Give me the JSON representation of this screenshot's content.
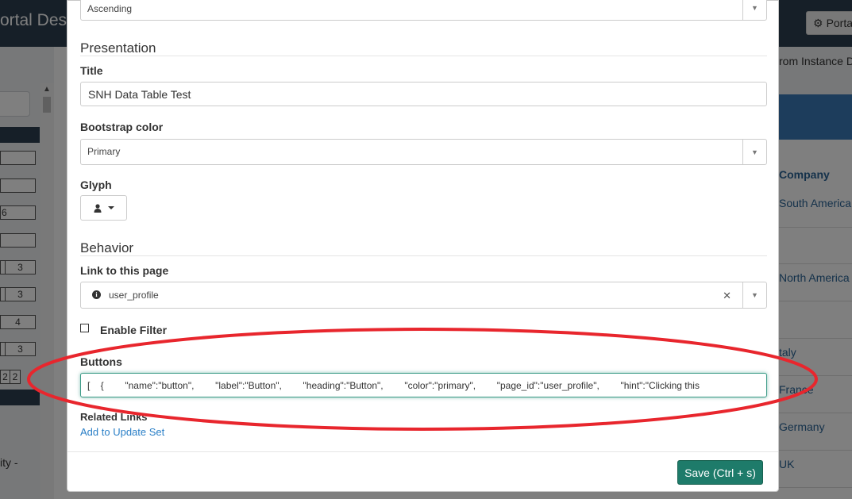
{
  "background": {
    "brand_title": "ortal Des",
    "portal_button_label": "Porta",
    "subheader_text": "rom Instance D",
    "left_numbers": [
      "6",
      "3",
      "3",
      "4",
      "3",
      "2",
      "2"
    ],
    "left_bottom_text": "ity -",
    "right_column_header": "Company",
    "right_rows": [
      "South America",
      "North America",
      "taly",
      "France",
      "Germany",
      "UK"
    ]
  },
  "modal": {
    "sort_order_select": "Ascending",
    "presentation_heading": "Presentation",
    "title_label": "Title",
    "title_value": "SNH Data Table Test",
    "bootstrap_color_label": "Bootstrap color",
    "bootstrap_color_value": "Primary",
    "glyph_label": "Glyph",
    "glyph_icon": "user-icon",
    "behavior_heading": "Behavior",
    "link_label": "Link to this page",
    "link_value": "user_profile",
    "link_icon": "info-circle-icon",
    "enable_filter_label": "Enable Filter",
    "enable_filter_checked": false,
    "buttons_label": "Buttons",
    "buttons_value": "[    {        \"name\":\"button\",        \"label\":\"Button\",        \"heading\":\"Button\",        \"color\":\"primary\",        \"page_id\":\"user_profile\",        \"hint\":\"Clicking this",
    "related_links_label": "Related Links",
    "add_link_text": "Add to Update Set",
    "save_button_label": "Save  (Ctrl + s)"
  },
  "annotation": {
    "color": "#e8262d",
    "shape": "ellipse"
  },
  "colors": {
    "topbar": "#2d3e50",
    "accent": "#1e7b6a",
    "link": "#2a7fc7"
  }
}
